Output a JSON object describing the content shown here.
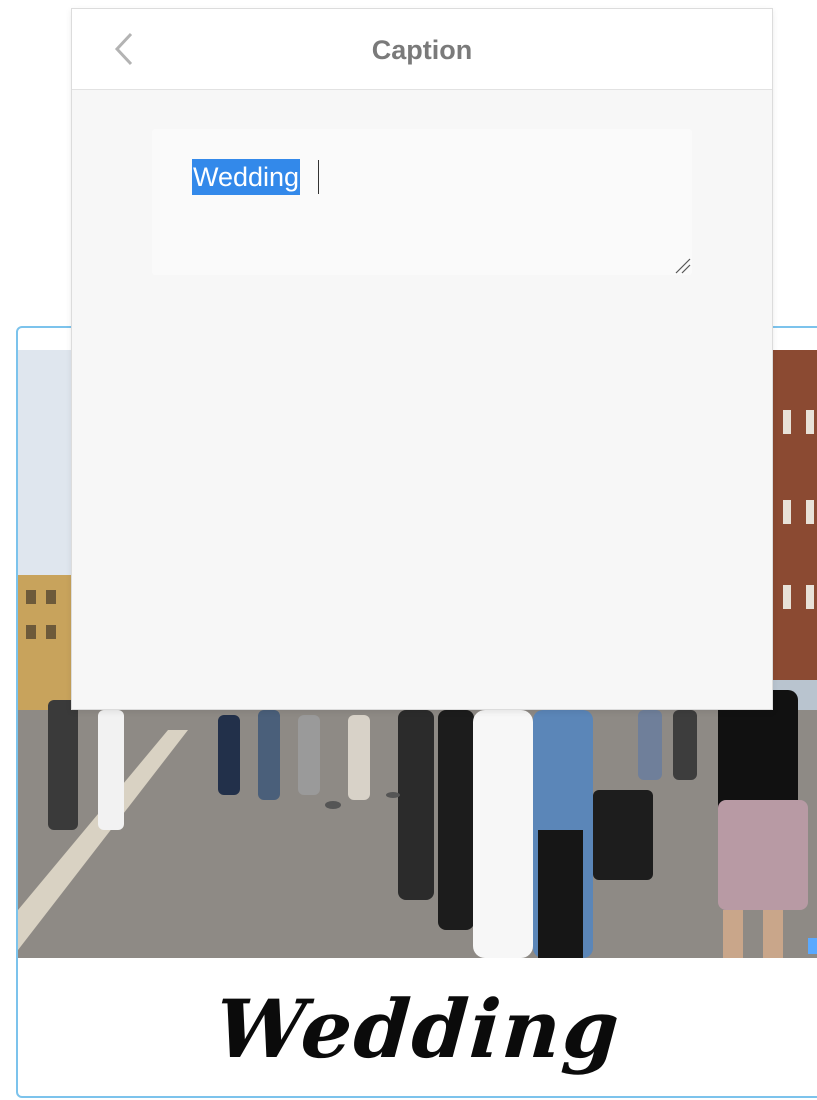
{
  "panel": {
    "title": "Caption",
    "back_icon": "chevron-left-icon"
  },
  "caption_field": {
    "value": "Wedding",
    "selected": true
  },
  "card": {
    "caption": "Wedding",
    "image_subject": "crowd in a city square with a bride in a white dress"
  },
  "colors": {
    "selection": "#3389ea",
    "card_border": "#7cc3ec",
    "panel_bg": "#f7f7f7"
  }
}
